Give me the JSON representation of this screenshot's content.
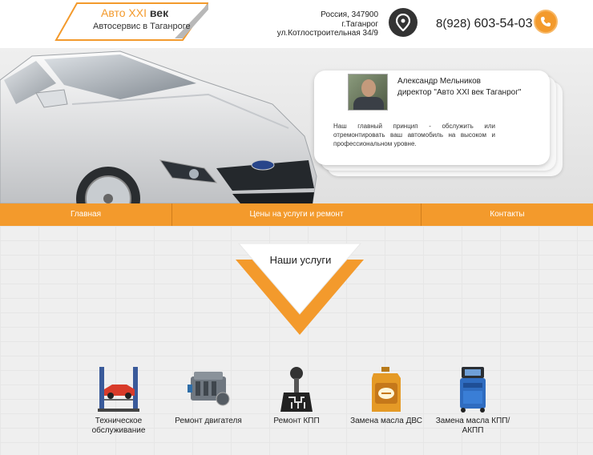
{
  "header": {
    "logo_title_orange": "Авто XXI",
    "logo_title_dark": "век",
    "logo_subtitle": "Автосервис в Таганроге",
    "address": [
      "Россия, 347900",
      "г.Таганрог",
      "ул.Котлостроительная 34/9"
    ],
    "phone_prefix": "8(928)",
    "phone_number": "603-54-03"
  },
  "hero": {
    "person_name": "Александр Мельников",
    "person_role": "директор \"Авто XXI век Таганрог\"",
    "quote": "Наш главный принцип - обслужить или отремонтировать ваш автомобиль на высоком и профессиональном уровне."
  },
  "nav": {
    "items": [
      {
        "label": "Главная"
      },
      {
        "label": "Цены на услуги и ремонт"
      },
      {
        "label": "Контакты"
      }
    ]
  },
  "services": {
    "title": "Наши услуги",
    "items": [
      {
        "label": "Техническое обслуживание",
        "icon": "car-lift-icon"
      },
      {
        "label": "Ремонт двигателя",
        "icon": "engine-icon"
      },
      {
        "label": "Ремонт КПП",
        "icon": "gear-shifter-icon"
      },
      {
        "label": "Замена масла ДВС",
        "icon": "oil-canister-icon"
      },
      {
        "label": "Замена масла КПП/АКПП",
        "icon": "oil-change-machine-icon"
      }
    ]
  },
  "colors": {
    "accent": "#f39a2c",
    "dark": "#333333"
  }
}
